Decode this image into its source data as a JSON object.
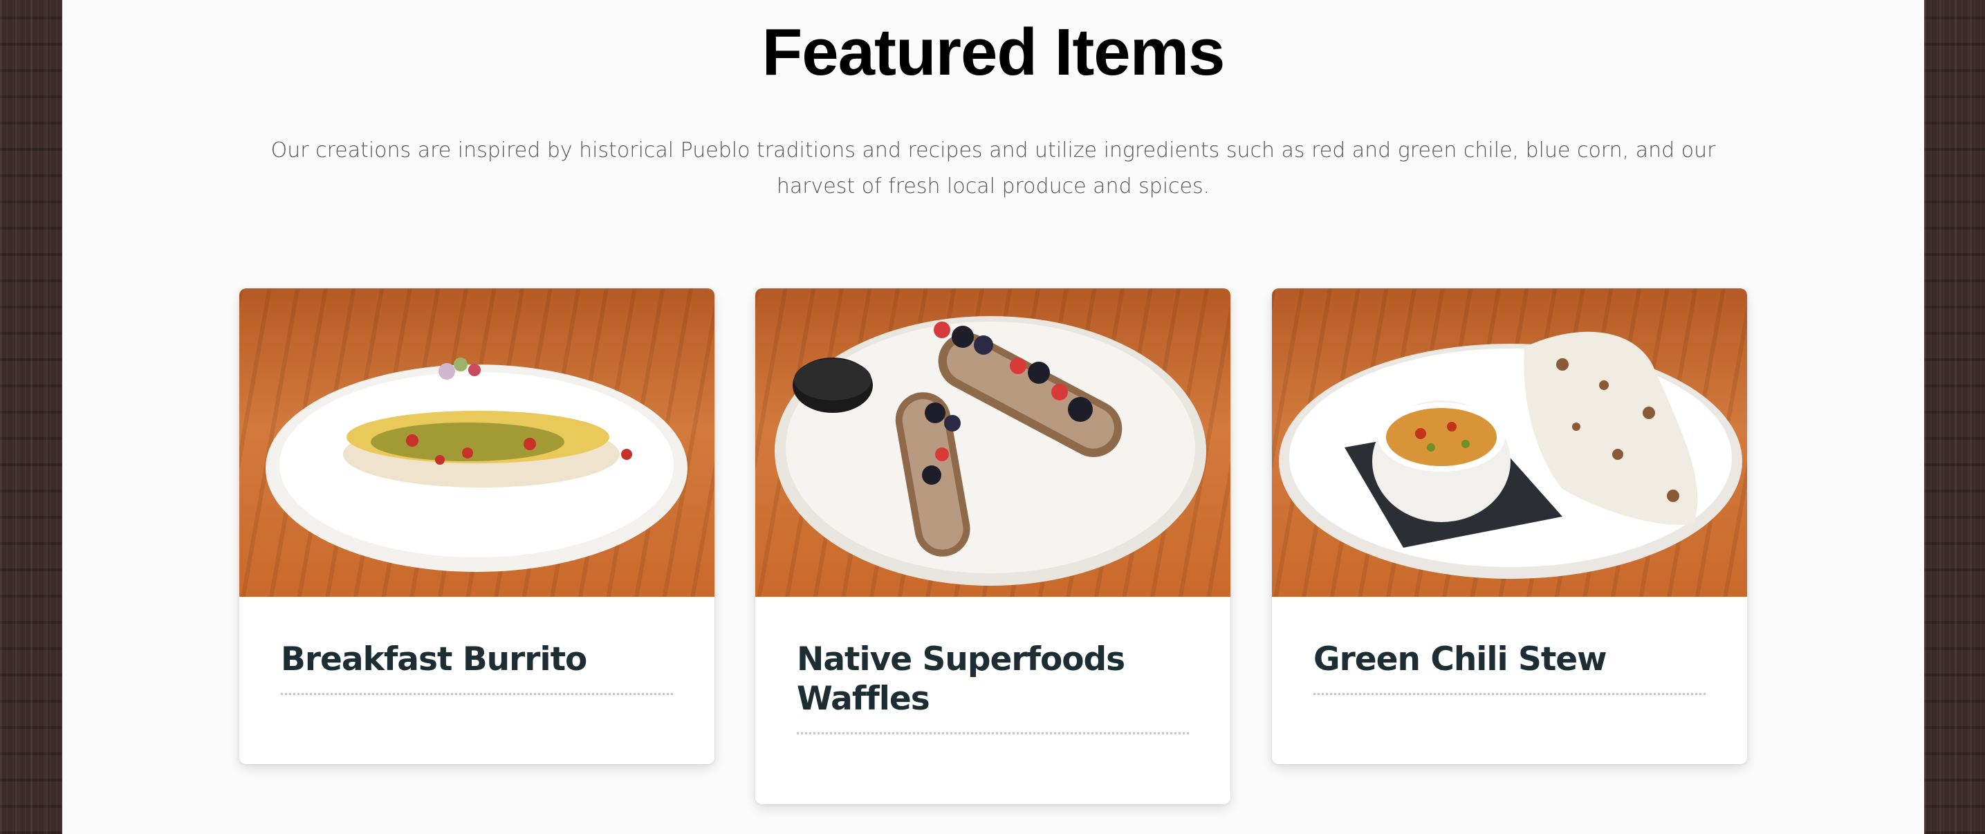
{
  "featured": {
    "title": "Featured Items",
    "intro": "Our creations are inspired by historical Pueblo traditions and recipes and utilize ingredients such as red and green chile, blue corn, and our harvest of fresh local produce and spices."
  },
  "items": [
    {
      "title": "Breakfast Burrito",
      "image_icon": "breakfast-burrito-photo"
    },
    {
      "title": "Native Superfoods Waffles",
      "image_icon": "waffles-photo"
    },
    {
      "title": "Green Chili Stew",
      "image_icon": "green-chili-stew-photo"
    }
  ],
  "colors": {
    "page_background": "#fbfbfb",
    "side_background": "#3b2a29",
    "card_title": "#1c2e33",
    "intro_text": "#555555",
    "heading": "#000000"
  }
}
